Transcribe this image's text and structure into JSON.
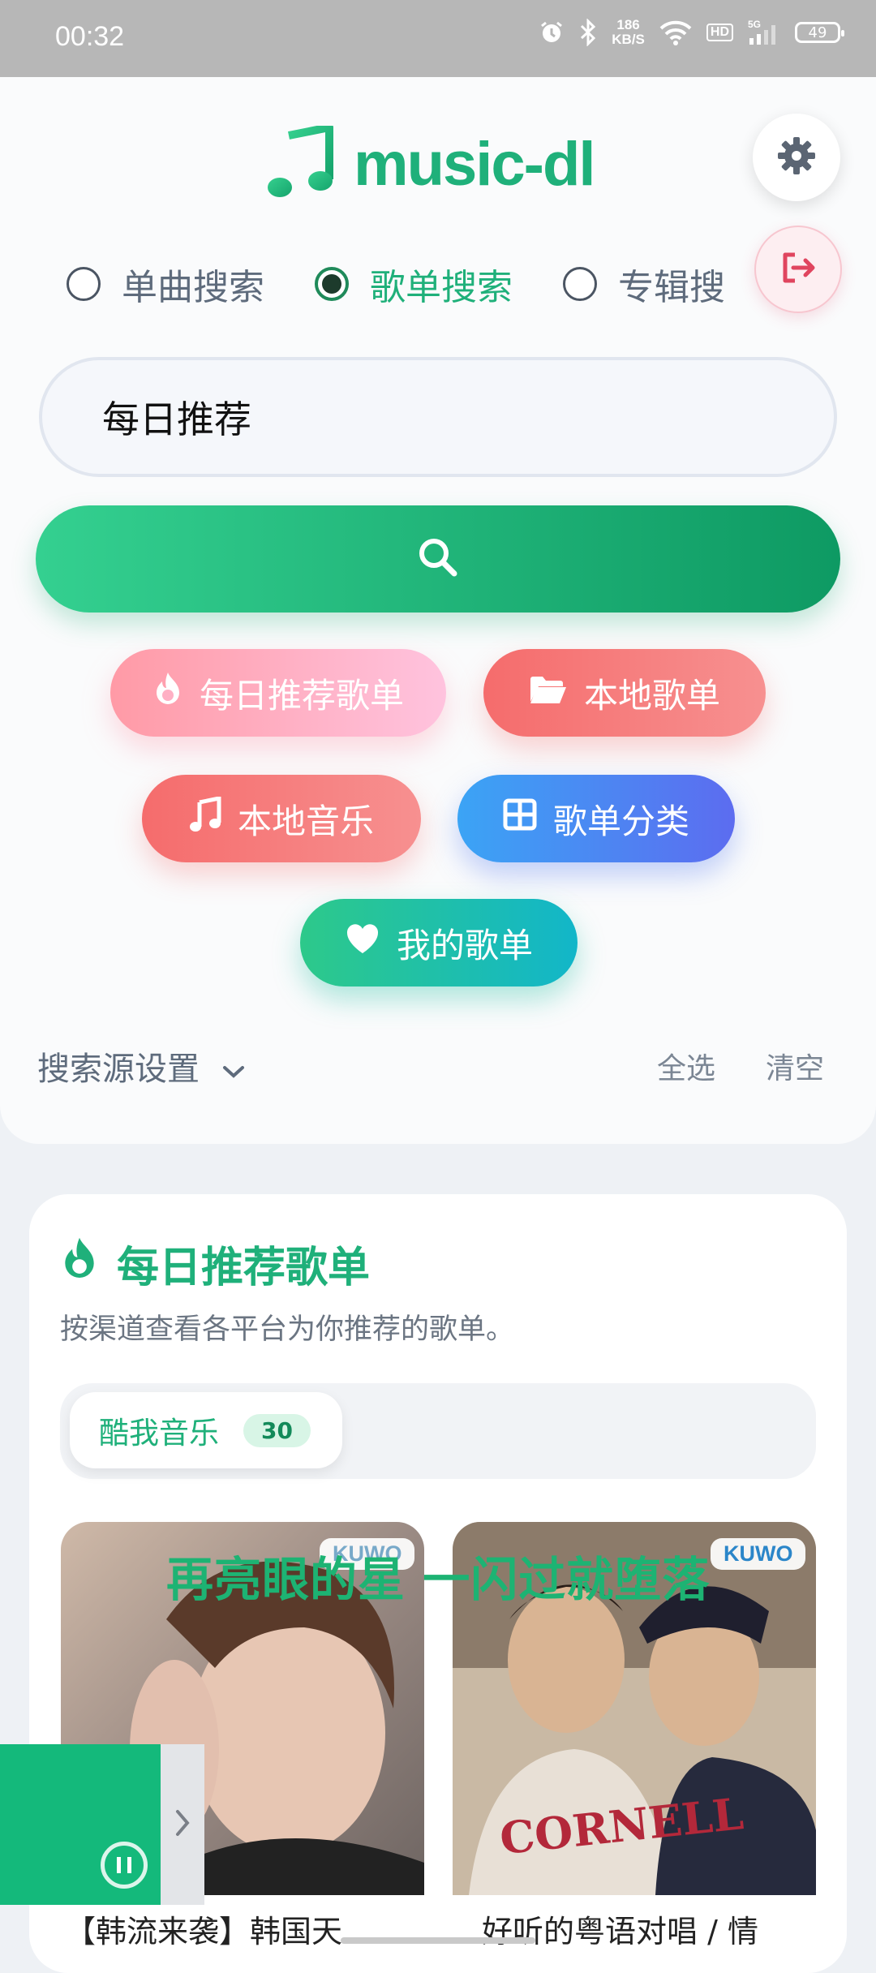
{
  "status_bar": {
    "time": "00:32",
    "net_speed_value": "186",
    "net_speed_unit": "KB/S",
    "hd": "HD",
    "signal": "5G",
    "battery": "49"
  },
  "header": {
    "app_name": "music-dl",
    "logo_icon": "music-note-icon",
    "settings_icon": "gear-icon",
    "logout_icon": "logout-icon"
  },
  "search_modes": [
    {
      "label": "单曲搜索",
      "selected": false
    },
    {
      "label": "歌单搜索",
      "selected": true
    },
    {
      "label": "专辑搜",
      "selected": false
    }
  ],
  "search": {
    "value": "每日推荐",
    "button_icon": "search-icon"
  },
  "quick_buttons": {
    "daily": "每日推荐歌单",
    "local_playlists": "本地歌单",
    "local_music": "本地音乐",
    "categories": "歌单分类",
    "my_playlists": "我的歌单"
  },
  "source_settings": {
    "label": "搜索源设置",
    "select_all": "全选",
    "clear": "清空"
  },
  "recommend": {
    "title": "每日推荐歌单",
    "description": "按渠道查看各平台为你推荐的歌单。",
    "tabs": [
      {
        "label": "酷我音乐",
        "count": "30"
      }
    ],
    "lyric_overlay": "再亮眼的星 一闪过就堕落",
    "cards": [
      {
        "badge": "KUWO",
        "title": "【韩流来袭】韩国天"
      },
      {
        "badge": "KUWO",
        "title": "好听的粤语对唱 / 情"
      }
    ]
  },
  "colors": {
    "accent": "#1fb07a",
    "pink": "#ff9aa6",
    "red": "#f56c6c",
    "blue": "#4a8cf2",
    "teal": "#1cc0a8"
  }
}
